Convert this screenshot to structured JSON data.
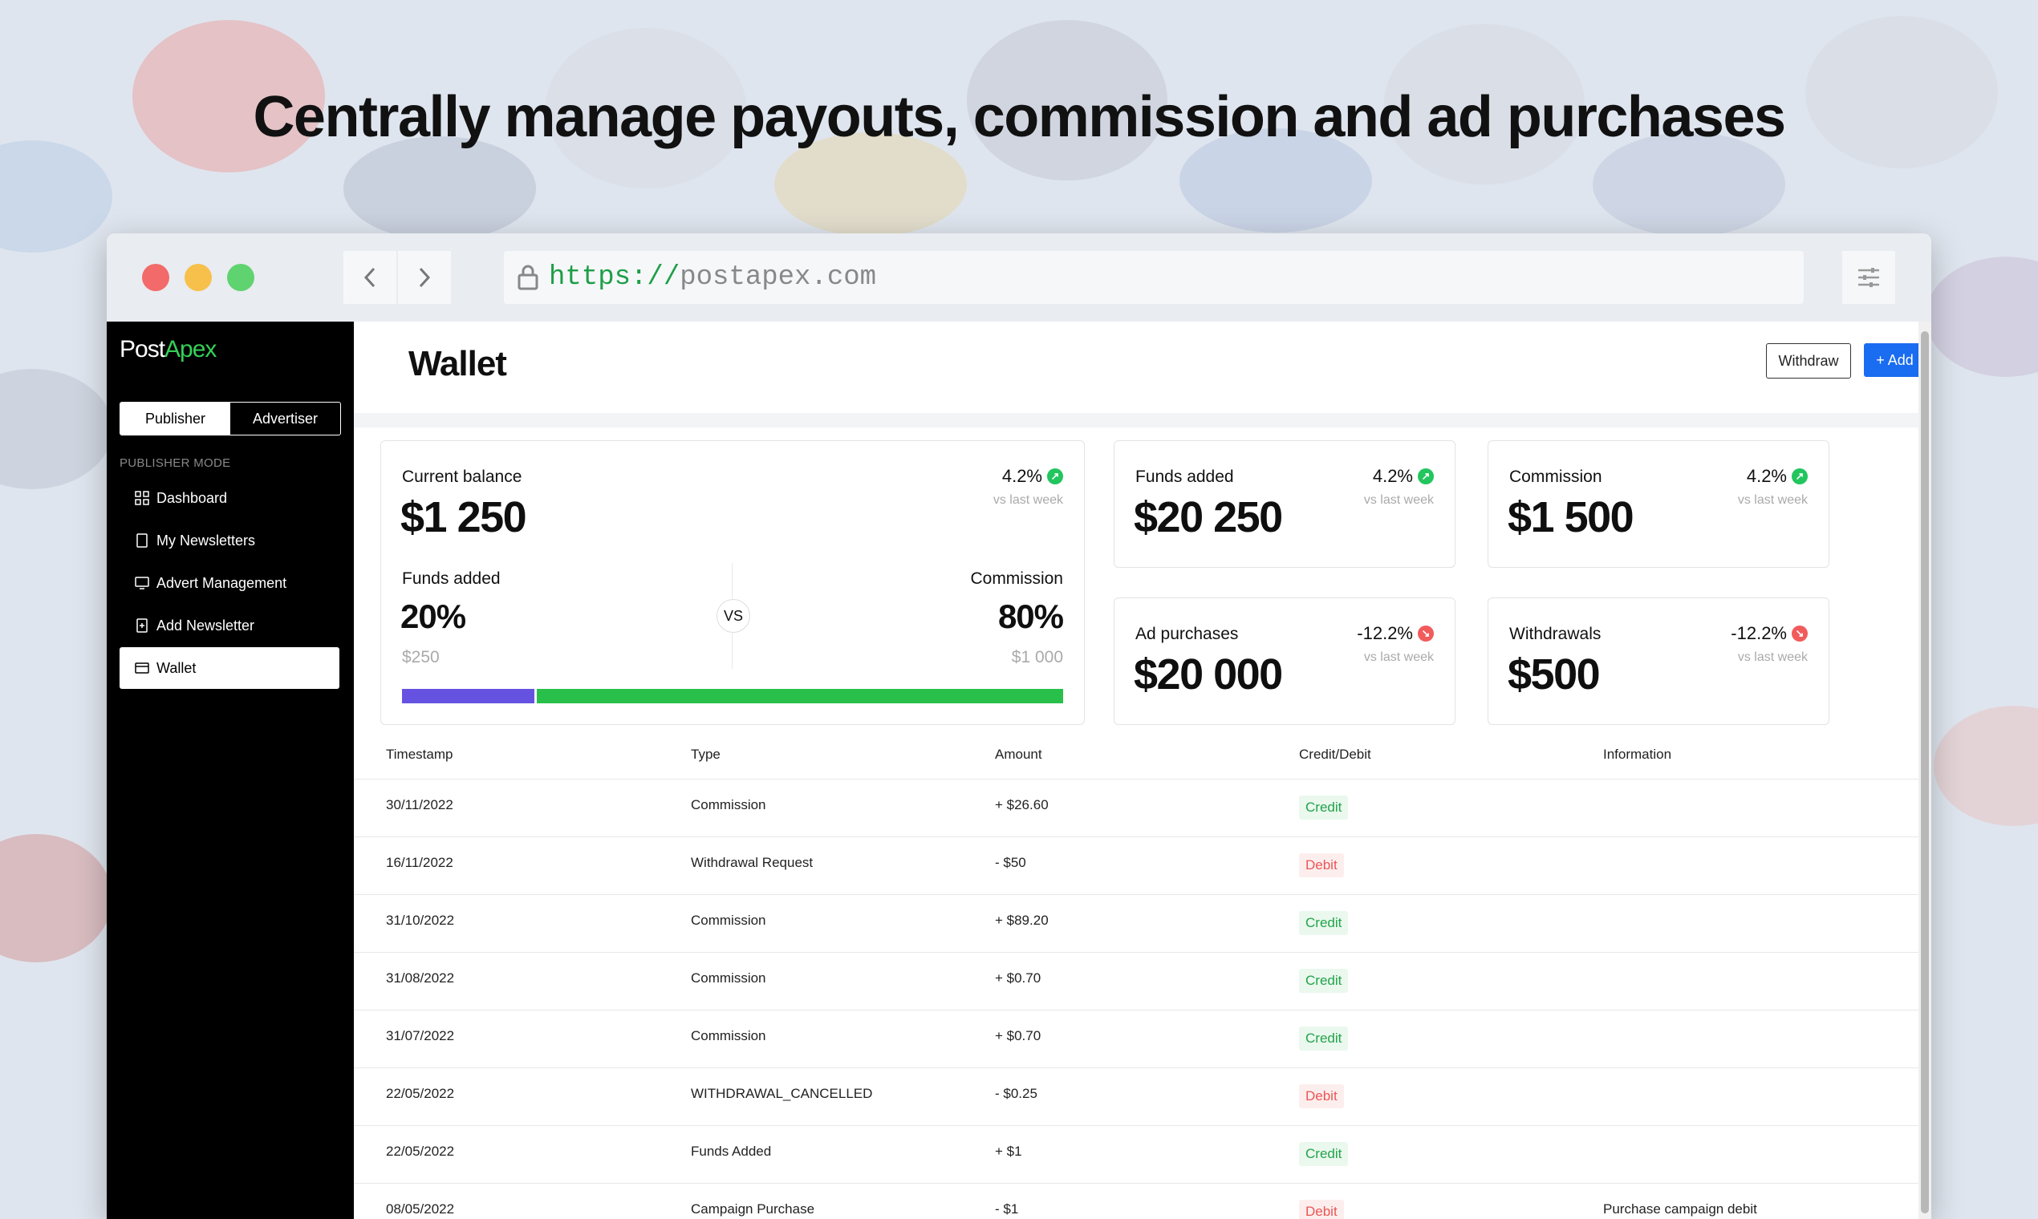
{
  "headline": "Centrally manage payouts, commission and ad purchases",
  "browser": {
    "url_scheme": "https://",
    "url_host": "postapex.com"
  },
  "colors": {
    "accent": "#1a6cf0",
    "brand_green": "#34d058",
    "credit": "#22a34a",
    "debit": "#ea5555"
  },
  "sidebar": {
    "logo_part1": "Post",
    "logo_part2": "Apex",
    "mode_publisher": "Publisher",
    "mode_advertiser": "Advertiser",
    "section_label": "PUBLISHER MODE",
    "items": [
      {
        "label": "Dashboard",
        "icon": "grid-icon"
      },
      {
        "label": "My Newsletters",
        "icon": "document-icon"
      },
      {
        "label": "Advert Management",
        "icon": "monitor-icon"
      },
      {
        "label": "Add Newsletter",
        "icon": "add-document-icon"
      },
      {
        "label": "Wallet",
        "icon": "wallet-icon"
      }
    ]
  },
  "header": {
    "title": "Wallet",
    "withdraw_label": "Withdraw",
    "add_funds_label": "+ Add Funds"
  },
  "balance_card": {
    "label": "Current balance",
    "value": "$1 250",
    "change": "4.2%",
    "change_note": "vs last week",
    "funds_label": "Funds added",
    "funds_pct": "20%",
    "funds_amount": "$250",
    "vs": "VS",
    "commission_label": "Commission",
    "commission_pct": "80%",
    "commission_amount": "$1 000",
    "split_fraction": 0.2
  },
  "stat_cards": [
    {
      "label": "Funds added",
      "value": "$20 250",
      "change": "4.2%",
      "note": "vs last week",
      "trend": "up"
    },
    {
      "label": "Commission",
      "value": "$1 500",
      "change": "4.2%",
      "note": "vs last week",
      "trend": "up"
    },
    {
      "label": "Ad purchases",
      "value": "$20 000",
      "change": "-12.2%",
      "note": "vs last week",
      "trend": "down"
    },
    {
      "label": "Withdrawals",
      "value": "$500",
      "change": "-12.2%",
      "note": "vs last week",
      "trend": "down"
    }
  ],
  "table": {
    "headers": [
      "Timestamp",
      "Type",
      "Amount",
      "Credit/Debit",
      "Information"
    ],
    "rows": [
      {
        "timestamp": "30/11/2022",
        "type": "Commission",
        "amount": "+ $26.60",
        "cd": "Credit",
        "info": ""
      },
      {
        "timestamp": "16/11/2022",
        "type": "Withdrawal Request",
        "amount": "- $50",
        "cd": "Debit",
        "info": ""
      },
      {
        "timestamp": "31/10/2022",
        "type": "Commission",
        "amount": "+ $89.20",
        "cd": "Credit",
        "info": ""
      },
      {
        "timestamp": "31/08/2022",
        "type": "Commission",
        "amount": "+ $0.70",
        "cd": "Credit",
        "info": ""
      },
      {
        "timestamp": "31/07/2022",
        "type": "Commission",
        "amount": "+ $0.70",
        "cd": "Credit",
        "info": ""
      },
      {
        "timestamp": "22/05/2022",
        "type": "WITHDRAWAL_CANCELLED",
        "amount": "- $0.25",
        "cd": "Debit",
        "info": ""
      },
      {
        "timestamp": "22/05/2022",
        "type": "Funds Added",
        "amount": "+ $1",
        "cd": "Credit",
        "info": ""
      },
      {
        "timestamp": "08/05/2022",
        "type": "Campaign Purchase",
        "amount": "- $1",
        "cd": "Debit",
        "info": "Purchase campaign debit"
      }
    ]
  }
}
